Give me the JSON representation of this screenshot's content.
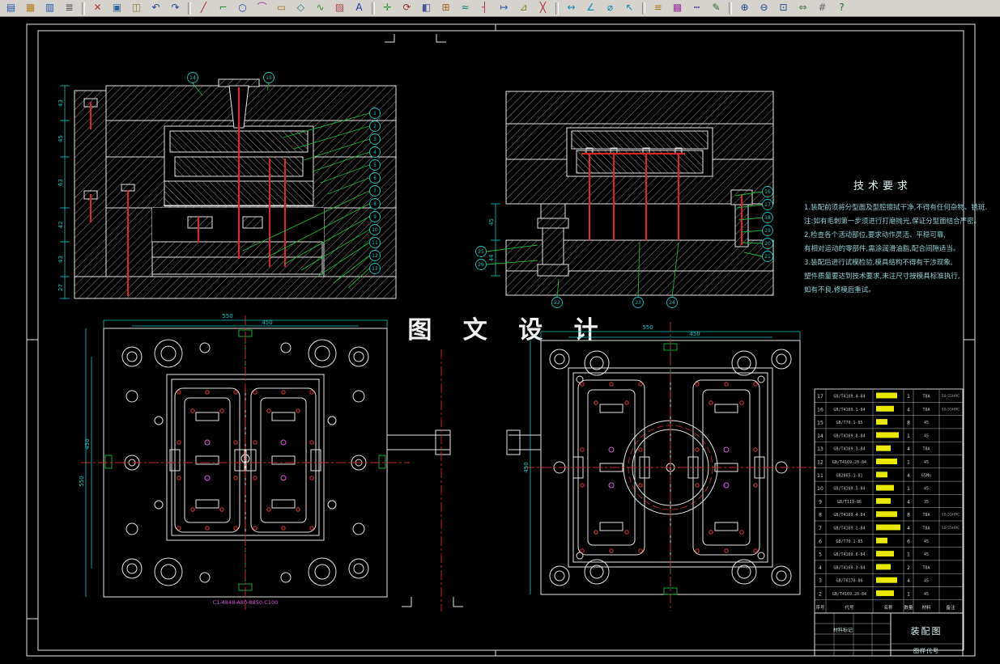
{
  "toolbar": {
    "icons": [
      {
        "name": "new",
        "g": "▤",
        "c": "#2255aa"
      },
      {
        "name": "open",
        "g": "▦",
        "c": "#b08020"
      },
      {
        "name": "save",
        "g": "▥",
        "c": "#2255aa"
      },
      {
        "name": "print",
        "g": "≣",
        "c": "#555555"
      },
      {
        "sep": true
      },
      {
        "name": "cut",
        "g": "✕",
        "c": "#aa3333"
      },
      {
        "name": "copy",
        "g": "▣",
        "c": "#336699"
      },
      {
        "name": "paste",
        "g": "◫",
        "c": "#887733"
      },
      {
        "name": "undo",
        "g": "↶",
        "c": "#224488"
      },
      {
        "name": "redo",
        "g": "↷",
        "c": "#224488"
      },
      {
        "sep": true
      },
      {
        "name": "line",
        "g": "╱",
        "c": "#aa2222"
      },
      {
        "name": "polyline",
        "g": "⌐",
        "c": "#228833"
      },
      {
        "name": "circle",
        "g": "○",
        "c": "#2244aa"
      },
      {
        "name": "arc",
        "g": "⌒",
        "c": "#993399"
      },
      {
        "name": "rectangle",
        "g": "▭",
        "c": "#aa7722"
      },
      {
        "name": "polygon",
        "g": "◇",
        "c": "#227788"
      },
      {
        "name": "spline",
        "g": "∿",
        "c": "#338833"
      },
      {
        "name": "hatch",
        "g": "▨",
        "c": "#aa4444"
      },
      {
        "name": "text",
        "g": "A",
        "c": "#2233aa"
      },
      {
        "sep": true
      },
      {
        "name": "move",
        "g": "✛",
        "c": "#338833"
      },
      {
        "name": "rotate",
        "g": "⟳",
        "c": "#883322"
      },
      {
        "name": "mirror",
        "g": "◧",
        "c": "#445599"
      },
      {
        "name": "array",
        "g": "⊞",
        "c": "#996622"
      },
      {
        "name": "offset",
        "g": "≈",
        "c": "#227777"
      },
      {
        "name": "trim",
        "g": "┤",
        "c": "#aa3355"
      },
      {
        "name": "extend",
        "g": "↦",
        "c": "#3355aa"
      },
      {
        "name": "fillet",
        "g": "⊿",
        "c": "#778822"
      },
      {
        "name": "erase",
        "g": "╳",
        "c": "#aa2222"
      },
      {
        "sep": true
      },
      {
        "name": "dim-linear",
        "g": "↔",
        "c": "#1188aa"
      },
      {
        "name": "dim-angular",
        "g": "∠",
        "c": "#1188aa"
      },
      {
        "name": "dim-radius",
        "g": "⌀",
        "c": "#1188aa"
      },
      {
        "name": "leader",
        "g": "↖",
        "c": "#1188aa"
      },
      {
        "sep": true
      },
      {
        "name": "layers",
        "g": "≡",
        "c": "#aa7711"
      },
      {
        "name": "color",
        "g": "▩",
        "c": "#993399"
      },
      {
        "name": "linetype",
        "g": "┅",
        "c": "#555599"
      },
      {
        "name": "properties",
        "g": "✎",
        "c": "#336633"
      },
      {
        "sep": true
      },
      {
        "name": "zoom-in",
        "g": "⊕",
        "c": "#224488"
      },
      {
        "name": "zoom-out",
        "g": "⊖",
        "c": "#224488"
      },
      {
        "name": "zoom-window",
        "g": "⊡",
        "c": "#224488"
      },
      {
        "name": "pan",
        "g": "⇔",
        "c": "#447744"
      },
      {
        "name": "measure",
        "g": "#",
        "c": "#666666"
      },
      {
        "name": "help",
        "g": "?",
        "c": "#226622"
      }
    ]
  },
  "drawing": {
    "watermark": "图 文 设 计",
    "plate_code": "C1-4848-A80-8850-C100",
    "tech_requirements": {
      "title": "技术要求",
      "lines": [
        "1.装配前须将分型面及型腔擦拭干净,不得有任何杂物、锈斑.",
        "注:如有毛刺第一步须进行打磨抛光,保证分型面结合严密。",
        "2.检查各个活动部位,要求动作灵活、平稳可靠,",
        "有相对运动的零部件,需涂润滑油脂,配合间隙适当。",
        "3.装配后进行试模检验,模具结构不得有干涉现象,",
        "塑件质量要达到技术要求,未注尺寸按模具标准执行,",
        "如有不良,修模后重试。"
      ]
    },
    "dims": {
      "plan_left": {
        "top_outer": "550",
        "top_inner": "450",
        "side_outer": "550",
        "side_inner": "450"
      },
      "plan_right": {
        "top_outer": "550",
        "top_inner": "450",
        "side": "450"
      },
      "sec_left_chain": [
        "43",
        "45",
        "63",
        "42",
        "43",
        "27"
      ],
      "sec_right_chain": [
        "45",
        "44"
      ]
    },
    "balloons": {
      "sec_left": [
        "1",
        "2",
        "3",
        "4",
        "5",
        "6",
        "7",
        "8",
        "9",
        "10",
        "11",
        "12",
        "13",
        "14",
        "15"
      ],
      "sec_right": [
        "16",
        "17",
        "18",
        "19",
        "20",
        "21",
        "22",
        "23",
        "24",
        "25",
        "26"
      ]
    }
  },
  "bom": {
    "headers": [
      "序号",
      "代号",
      "名称",
      "数量",
      "材料",
      "备注"
    ],
    "rows": [
      {
        "no": "17",
        "code": "GB/T4169.4-84",
        "qty": "1",
        "mat": "T8A",
        "rk": "50-55HRC",
        "bar": 26
      },
      {
        "no": "16",
        "code": "GB/T4169.1-84",
        "qty": "4",
        "mat": "T8A",
        "rk": "50-55HRC",
        "bar": 22
      },
      {
        "no": "15",
        "code": "GB/T70.1-85",
        "qty": "8",
        "mat": "45",
        "rk": "",
        "bar": 14
      },
      {
        "no": "14",
        "code": "GB/T4169.8-84",
        "qty": "1",
        "mat": "45",
        "rk": "",
        "bar": 28
      },
      {
        "no": "13",
        "code": "GB/T4169.3-84",
        "qty": "4",
        "mat": "T8A",
        "rk": "",
        "bar": 18
      },
      {
        "no": "12",
        "code": "GB/T4169.20-84",
        "qty": "1",
        "mat": "45",
        "rk": "",
        "bar": 26
      },
      {
        "no": "11",
        "code": "GB2865.1-81",
        "qty": "4",
        "mat": "65Mn",
        "rk": "",
        "bar": 14
      },
      {
        "no": "10",
        "code": "GB/T4169.5-84",
        "qty": "1",
        "mat": "45",
        "rk": "",
        "bar": 22
      },
      {
        "no": "9",
        "code": "GB/T119-86",
        "qty": "4",
        "mat": "35",
        "rk": "",
        "bar": 18
      },
      {
        "no": "8",
        "code": "GB/T4169.4-84",
        "qty": "8",
        "mat": "T8A",
        "rk": "50-55HRC",
        "bar": 26
      },
      {
        "no": "7",
        "code": "GB/T4169.1-84",
        "qty": "4",
        "mat": "T8A",
        "rk": "50-55HRC",
        "bar": 30
      },
      {
        "no": "6",
        "code": "GB/T70.1-85",
        "qty": "6",
        "mat": "45",
        "rk": "",
        "bar": 14
      },
      {
        "no": "5",
        "code": "GB/T4169.8-84",
        "qty": "1",
        "mat": "45",
        "rk": "",
        "bar": 22
      },
      {
        "no": "4",
        "code": "GB/T4169.3-84",
        "qty": "2",
        "mat": "T8A",
        "rk": "",
        "bar": 18
      },
      {
        "no": "3",
        "code": "GB/T6170-86",
        "qty": "4",
        "mat": "45",
        "rk": "",
        "bar": 26
      },
      {
        "no": "2",
        "code": "GB/T4169.20-84",
        "qty": "1",
        "mat": "45",
        "rk": "",
        "bar": 22
      }
    ]
  },
  "title_block": {
    "material_label": "材料标记",
    "drawing_name": "装配图",
    "code_label": "图样代号"
  }
}
